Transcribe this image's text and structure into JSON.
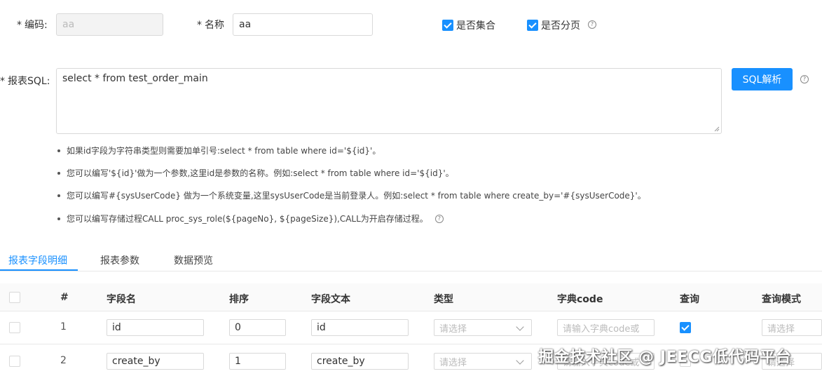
{
  "form": {
    "code": {
      "label": "编码:",
      "value": "aa"
    },
    "name": {
      "label": "名称",
      "value": "aa"
    },
    "is_collection": {
      "label": "是否集合",
      "checked": true
    },
    "is_paged": {
      "label": "是否分页",
      "checked": true
    },
    "sql": {
      "label": "报表SQL:",
      "value": "select * from test_order_main"
    },
    "sql_parse_button": "SQL解析",
    "help_glyph": "?"
  },
  "tips": [
    "如果id字段为字符串类型则需要加单引号:select * from table where id='${id}'。",
    "您可以编写'${id}'做为一个参数,这里id是参数的名称。例如:select * from table where id='${id}'。",
    "您可以编写#{sysUserCode} 做为一个系统变量,这里sysUserCode是当前登录人。例如:select * from table where create_by='#{sysUserCode}'。",
    "您可以编写存储过程CALL proc_sys_role(${pageNo}, ${pageSize}),CALL为开启存储过程。"
  ],
  "tabs": [
    {
      "label": "报表字段明细",
      "active": true
    },
    {
      "label": "报表参数",
      "active": false
    },
    {
      "label": "数据预览",
      "active": false
    }
  ],
  "table": {
    "headers": [
      "#",
      "字段名",
      "排序",
      "字段文本",
      "类型",
      "字典code",
      "查询",
      "查询模式"
    ],
    "rows": [
      {
        "index": "1",
        "field_name": "id",
        "order": "0",
        "field_text": "id",
        "type_placeholder": "请选择",
        "dict_placeholder": "请输入字典code或",
        "query": true,
        "mode_placeholder": "请选择"
      },
      {
        "index": "2",
        "field_name": "create_by",
        "order": "1",
        "field_text": "create_by",
        "type_placeholder": "请选择",
        "dict_placeholder": "请输入字典code或",
        "query": false,
        "mode_placeholder": "请选择"
      }
    ]
  },
  "watermark": "掘金技术社区 @ JEECG低代码平台",
  "colors": {
    "accent": "#1890ff",
    "header_bg": "#fafafa",
    "border": "#d9d9d9"
  }
}
